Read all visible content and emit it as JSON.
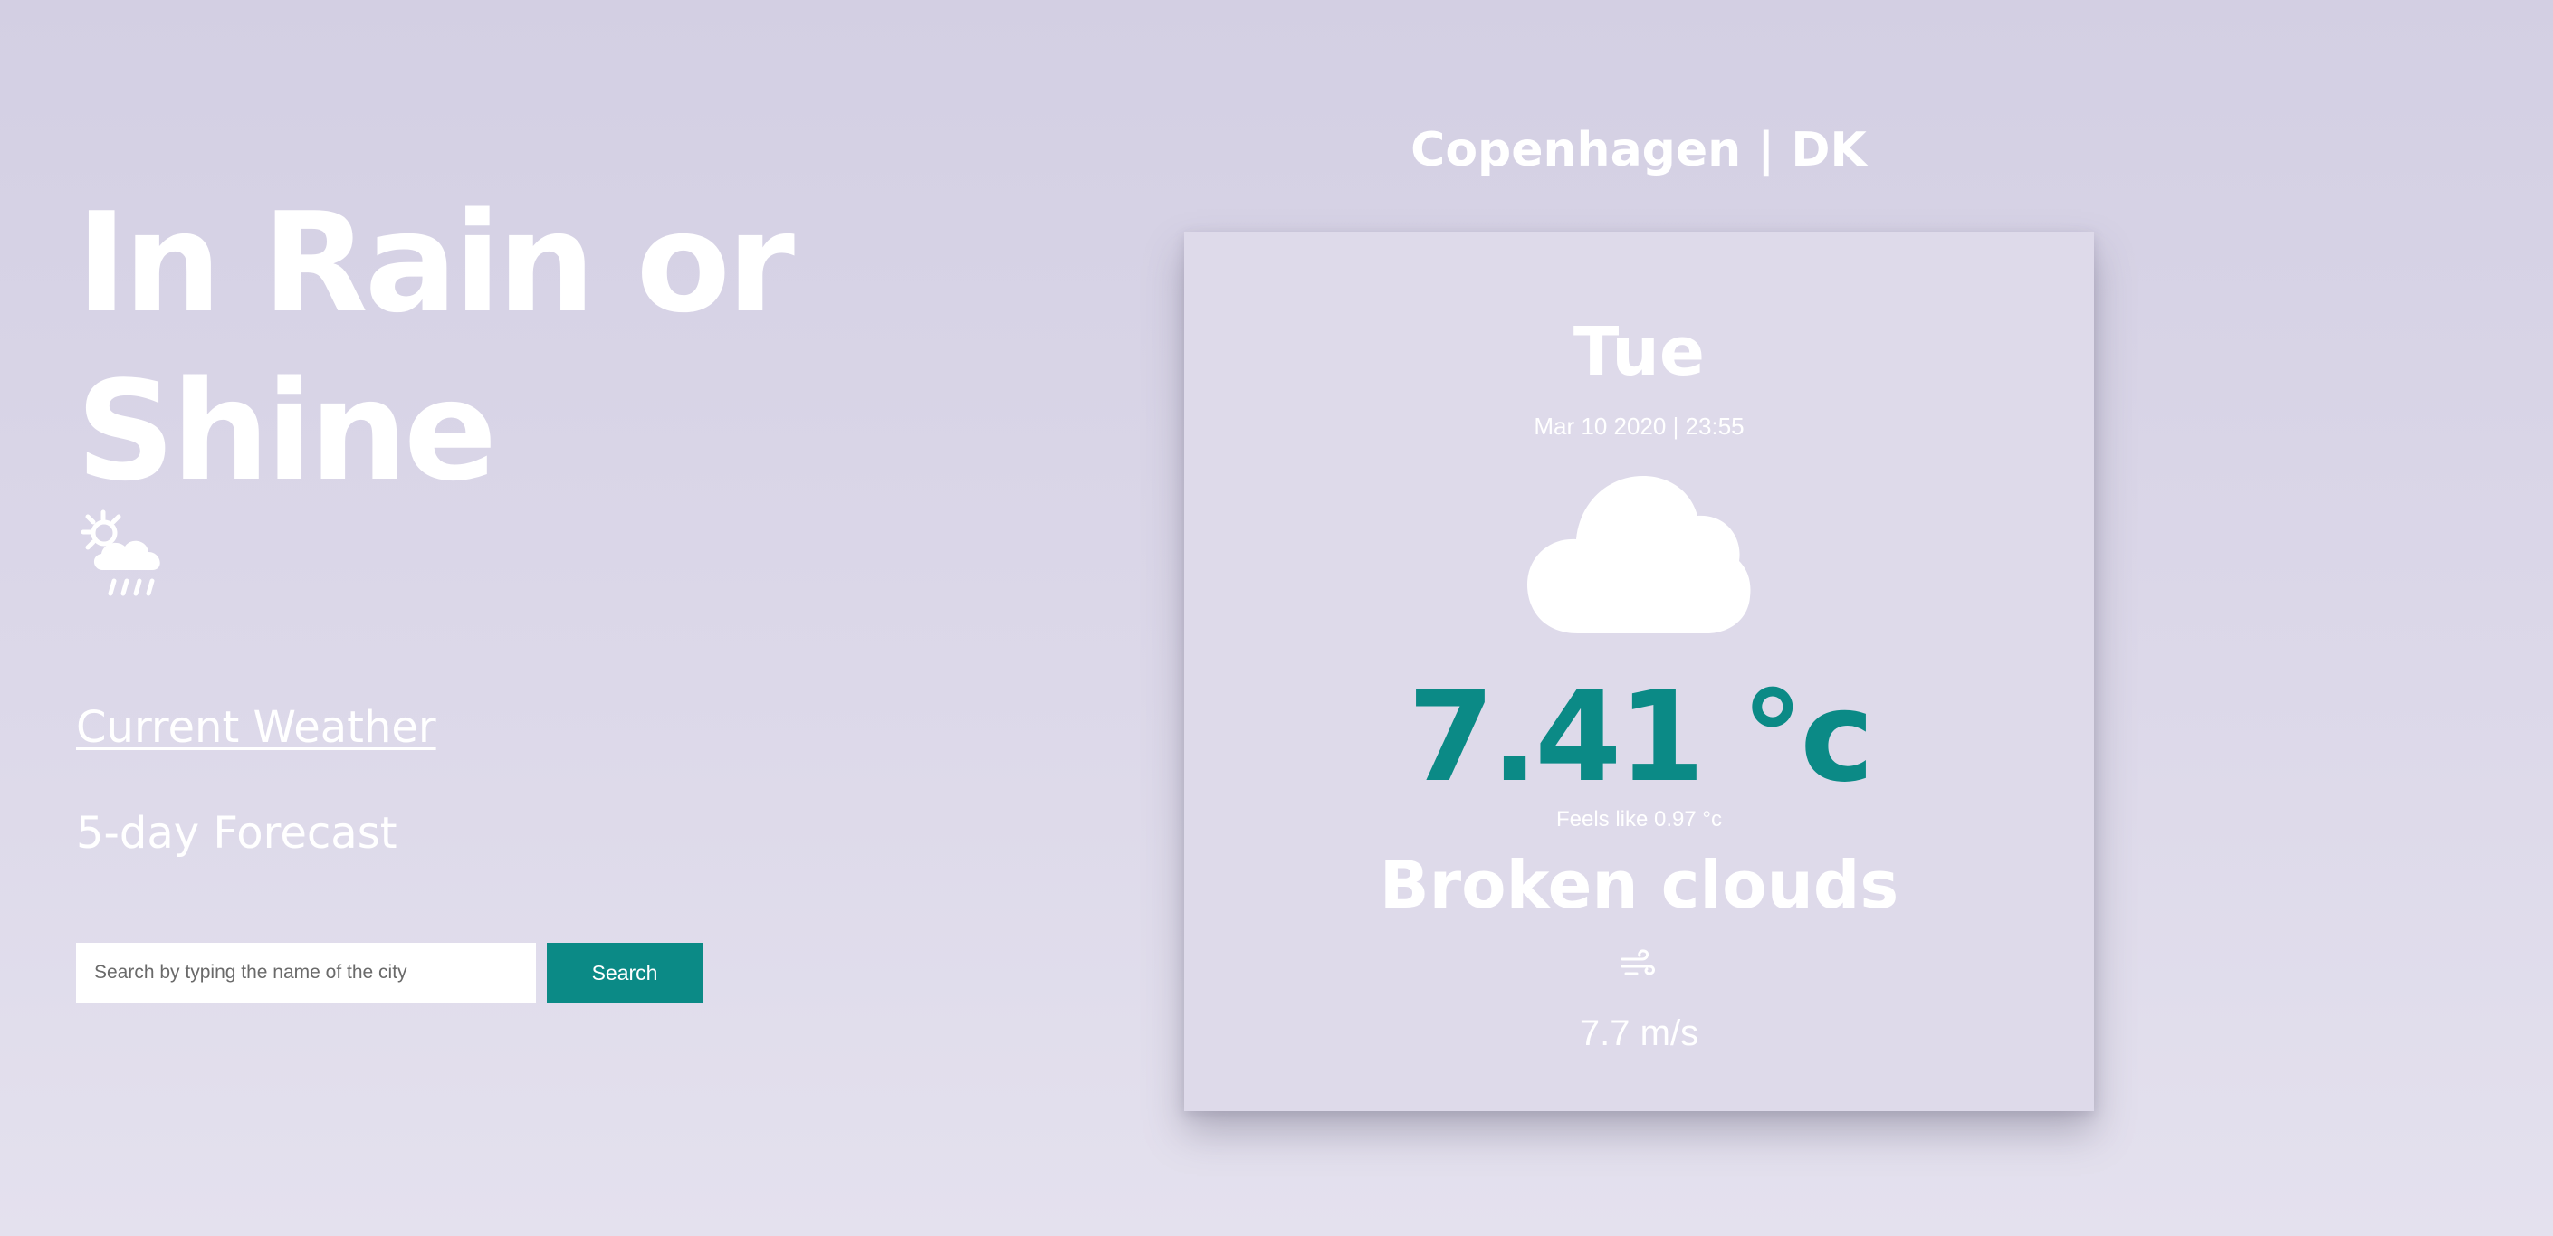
{
  "hero": {
    "title": "In Rain or Shine",
    "icon": "sun-behind-rain-cloud-icon"
  },
  "nav": {
    "current_weather": "Current Weather",
    "forecast": "5-day Forecast"
  },
  "search": {
    "placeholder": "Search by typing the name of the city",
    "value": "",
    "button_label": "Search"
  },
  "weather": {
    "location": "Copenhagen | DK",
    "day": "Tue",
    "datetime": "Mar 10 2020 | 23:55",
    "condition_icon": "cloud-icon",
    "temperature": "7.41 °c",
    "feels_like": "Feels like 0.97 °c",
    "condition": "Broken clouds",
    "wind_icon": "wind-icon",
    "wind_speed": "7.7 m/s"
  },
  "colors": {
    "accent": "#0b8a86",
    "background_top": "#d3cfe3",
    "background_bottom": "#e4e1ee",
    "card": "#dedaea",
    "text": "#ffffff"
  }
}
